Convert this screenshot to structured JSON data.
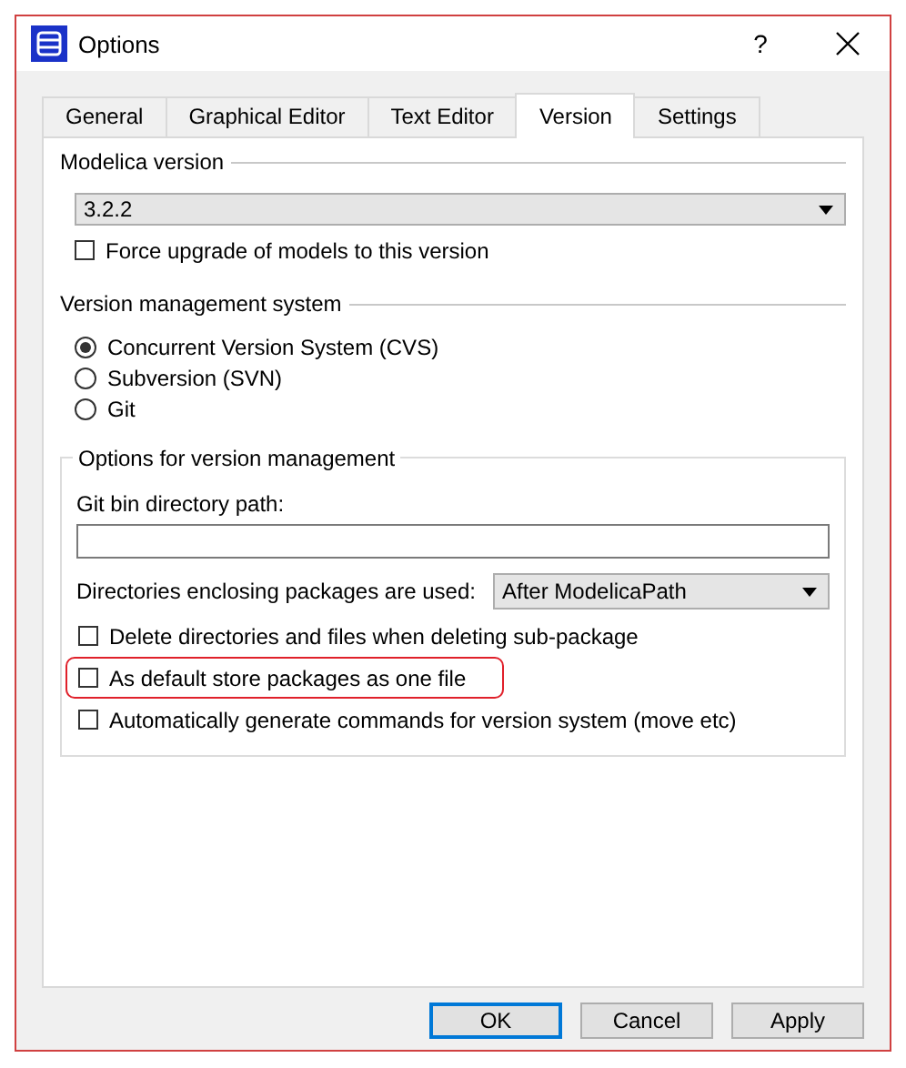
{
  "window": {
    "title": "Options",
    "help": "?"
  },
  "tabs": [
    {
      "label": "General",
      "selected": false
    },
    {
      "label": "Graphical Editor",
      "selected": false
    },
    {
      "label": "Text Editor",
      "selected": false
    },
    {
      "label": "Version",
      "selected": true
    },
    {
      "label": "Settings",
      "selected": false
    }
  ],
  "modelica_version": {
    "title": "Modelica version",
    "value": "3.2.2",
    "force_upgrade": {
      "label": "Force upgrade of models to this version",
      "checked": false
    }
  },
  "version_management_system": {
    "title": "Version management system",
    "options": [
      {
        "label": "Concurrent Version System (CVS)",
        "selected": true
      },
      {
        "label": "Subversion (SVN)",
        "selected": false
      },
      {
        "label": "Git",
        "selected": false
      }
    ]
  },
  "options_for_version_management": {
    "title": "Options for version management",
    "git_path_label": "Git bin directory path:",
    "directories_label": "Directories enclosing packages are used:",
    "directories_value": "After ModelicaPath",
    "checkboxes": [
      {
        "label": "Delete directories and files when deleting sub-package",
        "checked": false,
        "highlighted": false
      },
      {
        "label": "As default store packages as one file",
        "checked": false,
        "highlighted": true
      },
      {
        "label": "Automatically generate commands for version system (move etc)",
        "checked": false,
        "highlighted": false
      }
    ]
  },
  "buttons": [
    {
      "label": "OK",
      "default": true
    },
    {
      "label": "Cancel",
      "default": false
    },
    {
      "label": "Apply",
      "default": false
    }
  ]
}
